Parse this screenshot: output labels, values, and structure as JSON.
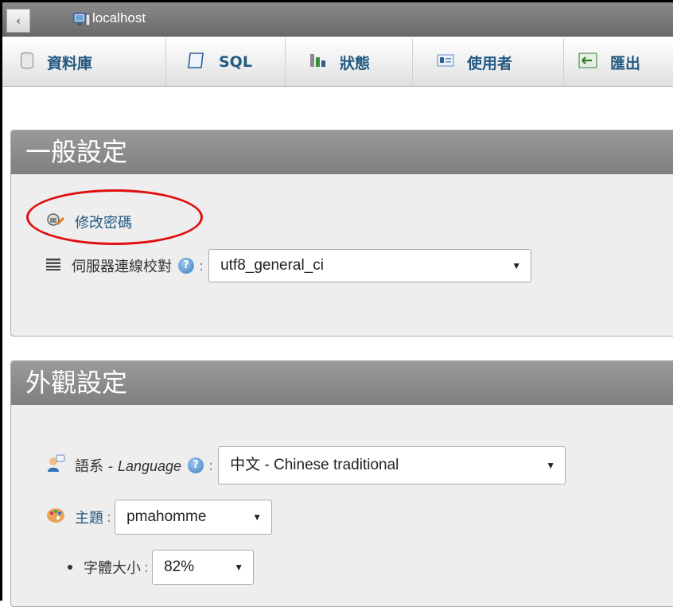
{
  "topbar": {
    "collapse_glyph": "‹",
    "server_label": "localhost"
  },
  "menu": {
    "tabs": [
      {
        "label": "資料庫",
        "icon": "database-icon"
      },
      {
        "label": "SQL",
        "icon": "sql-icon"
      },
      {
        "label": "狀態",
        "icon": "status-chart-icon"
      },
      {
        "label": "使用者",
        "icon": "users-icon"
      },
      {
        "label": "匯出",
        "icon": "export-icon"
      }
    ]
  },
  "general_settings": {
    "title": "一般設定",
    "change_password_label": "修改密碼",
    "collation_label": "伺服器連線校對",
    "collation_value": "utf8_general_ci"
  },
  "appearance_settings": {
    "title": "外觀設定",
    "language_label": "語系 - ",
    "language_label_italic": "Language",
    "language_value": "中文 - Chinese traditional",
    "theme_label": "主題",
    "theme_value": "pmahomme",
    "font_size_label": "字體大小",
    "font_size_value": "82%"
  },
  "colors": {
    "link": "#235a81",
    "annotation": "#e01010"
  }
}
